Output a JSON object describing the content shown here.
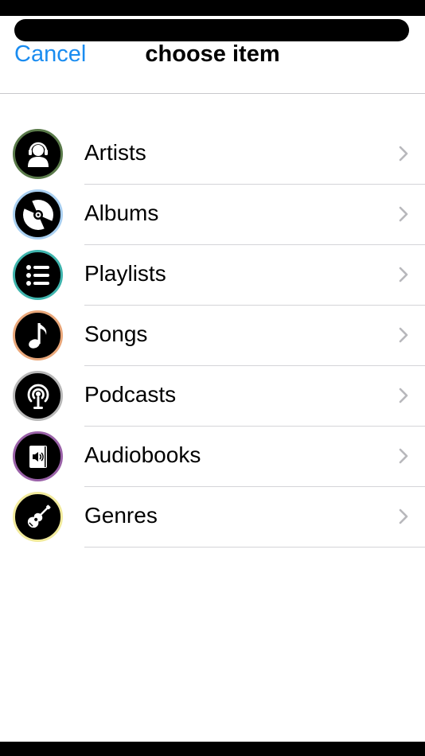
{
  "header": {
    "cancel_label": "Cancel",
    "title": "choose item"
  },
  "colors": {
    "accent": "#1a8cf0"
  },
  "items": [
    {
      "label": "Artists",
      "icon": "artist-headset-icon",
      "ring": "#5a7a4a"
    },
    {
      "label": "Albums",
      "icon": "album-disc-icon",
      "ring": "#a9cff0"
    },
    {
      "label": "Playlists",
      "icon": "playlist-list-icon",
      "ring": "#3fb4ad"
    },
    {
      "label": "Songs",
      "icon": "music-note-icon",
      "ring": "#e9a77a"
    },
    {
      "label": "Podcasts",
      "icon": "podcast-icon",
      "ring": "#b8b8b8"
    },
    {
      "label": "Audiobooks",
      "icon": "audiobook-icon",
      "ring": "#9a62a8"
    },
    {
      "label": "Genres",
      "icon": "guitar-icon",
      "ring": "#f1ea9c"
    }
  ]
}
